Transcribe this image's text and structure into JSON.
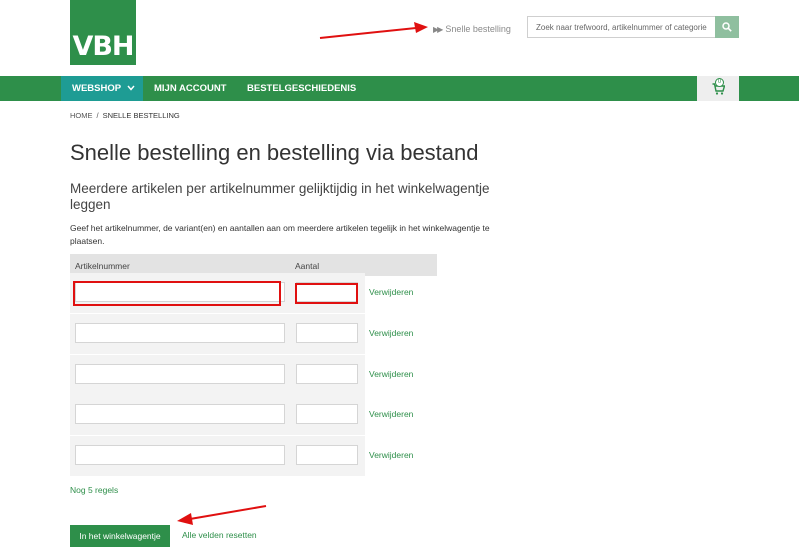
{
  "header": {
    "logo_text": "VBH",
    "quick_order_label": "Snelle bestelling",
    "search": {
      "placeholder": "Zoek naar trefwoord, artikelnummer of categorie..."
    }
  },
  "nav": {
    "items": [
      "WEBSHOP",
      "MIJN ACCOUNT",
      "BESTELGESCHIEDENIS"
    ],
    "cart_count": "0"
  },
  "breadcrumb": {
    "home": "HOME",
    "separator": "/",
    "current": "SNELLE BESTELLING"
  },
  "page": {
    "title": "Snelle bestelling en bestelling via bestand",
    "subtitle": "Meerdere artikelen per artikelnummer gelijktijdig in het winkelwagentje leggen",
    "description": "Geef het artikelnummer, de variant(en) en aantallen aan om meerdere artikelen tegelijk in het winkelwagentje te plaatsen."
  },
  "table": {
    "headers": {
      "article": "Artikelnummer",
      "quantity": "Aantal"
    },
    "rows": [
      {
        "article": "",
        "quantity": "",
        "remove_label": "Verwijderen"
      },
      {
        "article": "",
        "quantity": "",
        "remove_label": "Verwijderen"
      },
      {
        "article": "",
        "quantity": "",
        "remove_label": "Verwijderen"
      },
      {
        "article": "",
        "quantity": "",
        "remove_label": "Verwijderen"
      },
      {
        "article": "",
        "quantity": "",
        "remove_label": "Verwijderen"
      }
    ]
  },
  "actions": {
    "more_rows": "Nog 5 regels",
    "add_to_cart": "In het winkelwagentje",
    "reset": "Alle velden resetten"
  },
  "colors": {
    "brand_green": "#2e8f4a",
    "active_teal": "#1e9c94",
    "annotation_red": "#e01010"
  }
}
